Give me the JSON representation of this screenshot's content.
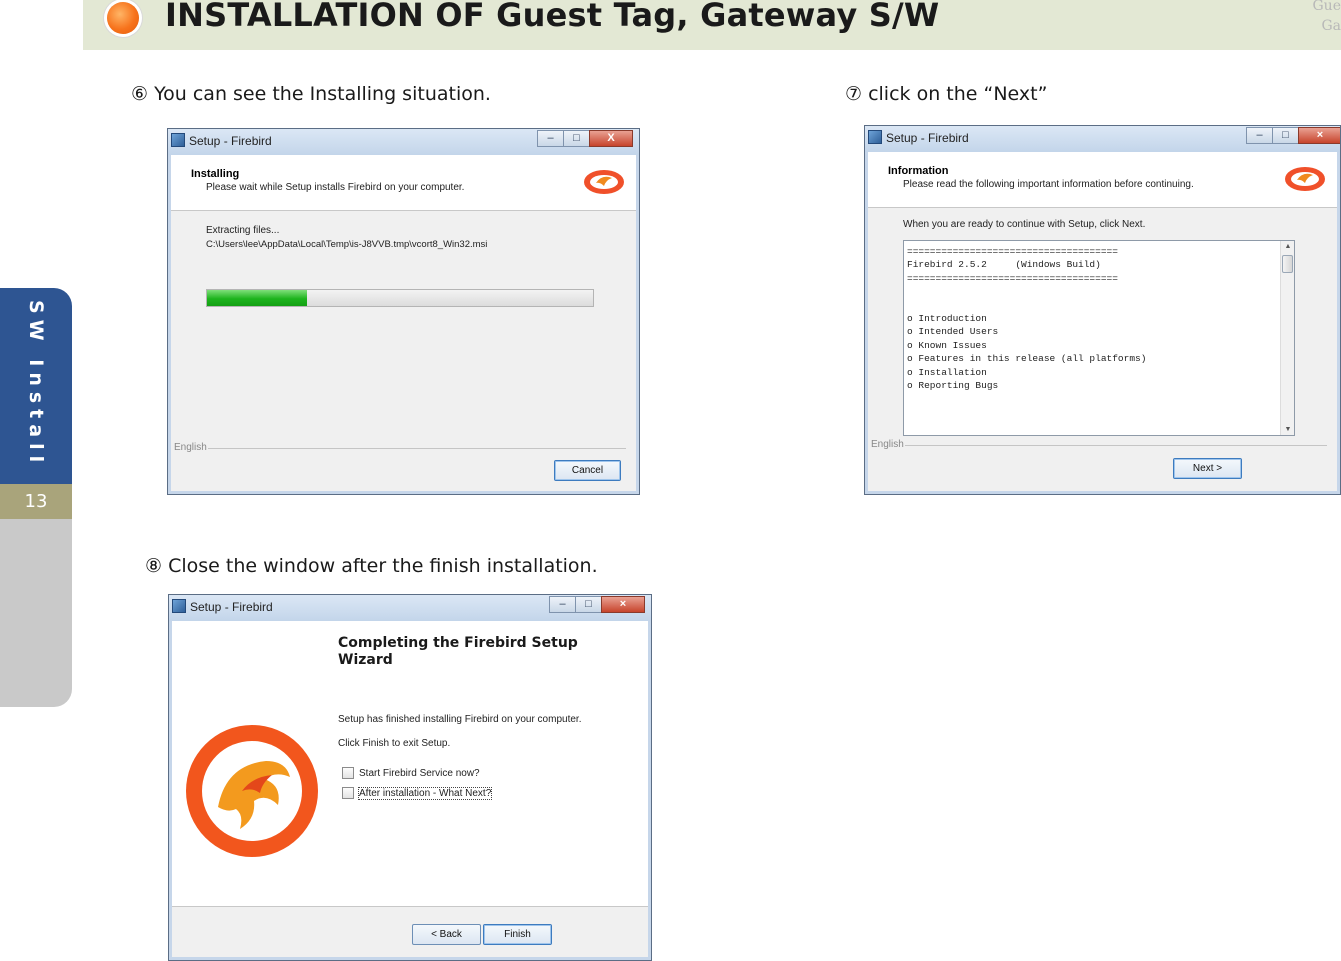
{
  "header": {
    "title": "INSTALLATION OF Guest Tag, Gateway S/W",
    "corner_lines": [
      "Gue",
      "Ga"
    ]
  },
  "sidebar": {
    "section_label": "SW Install",
    "page_number": "13"
  },
  "steps": {
    "step6": "⑥ You can see the Installing situation.",
    "step7": "⑦ click on the “Next”",
    "step8": "⑧ Close the window after the finish installation."
  },
  "dialog_installing": {
    "window_title": "Setup - Firebird",
    "close_glyph": "X",
    "heading": "Installing",
    "subheading": "Please wait while Setup installs Firebird on your computer.",
    "status_line1": "Extracting files...",
    "status_line2": "C:\\Users\\lee\\AppData\\Local\\Temp\\is-J8VVB.tmp\\vcort8_Win32.msi",
    "progress": 0.26,
    "language": "English",
    "cancel_button": "Cancel"
  },
  "dialog_information": {
    "window_title": "Setup - Firebird",
    "heading": "Information",
    "subheading": "Please read the following important information before continuing.",
    "instruction": "When you are ready to continue with Setup, click Next.",
    "readme_text": "=====================================\nFirebird 2.5.2     (Windows Build)\n=====================================\n\n\no Introduction\no Intended Users\no Known Issues\no Features in this release (all platforms)\no Installation\no Reporting Bugs",
    "language": "English",
    "next_button": "Next >"
  },
  "dialog_complete": {
    "window_title": "Setup - Firebird",
    "heading": "Completing the Firebird Setup Wizard",
    "line1": "Setup has finished installing Firebird on your computer.",
    "line2": "Click Finish to exit Setup.",
    "checkbox1": "Start Firebird Service now?",
    "checkbox2": "After installation - What Next?",
    "back_button": "< Back",
    "finish_button": "Finish"
  },
  "colors": {
    "header_band": "#e3e8d4",
    "accent_dot": "#f7731c",
    "sidebar_blue": "#2e5592",
    "page_number_bg": "#a9a47b",
    "progress_green": "#1db41d"
  }
}
